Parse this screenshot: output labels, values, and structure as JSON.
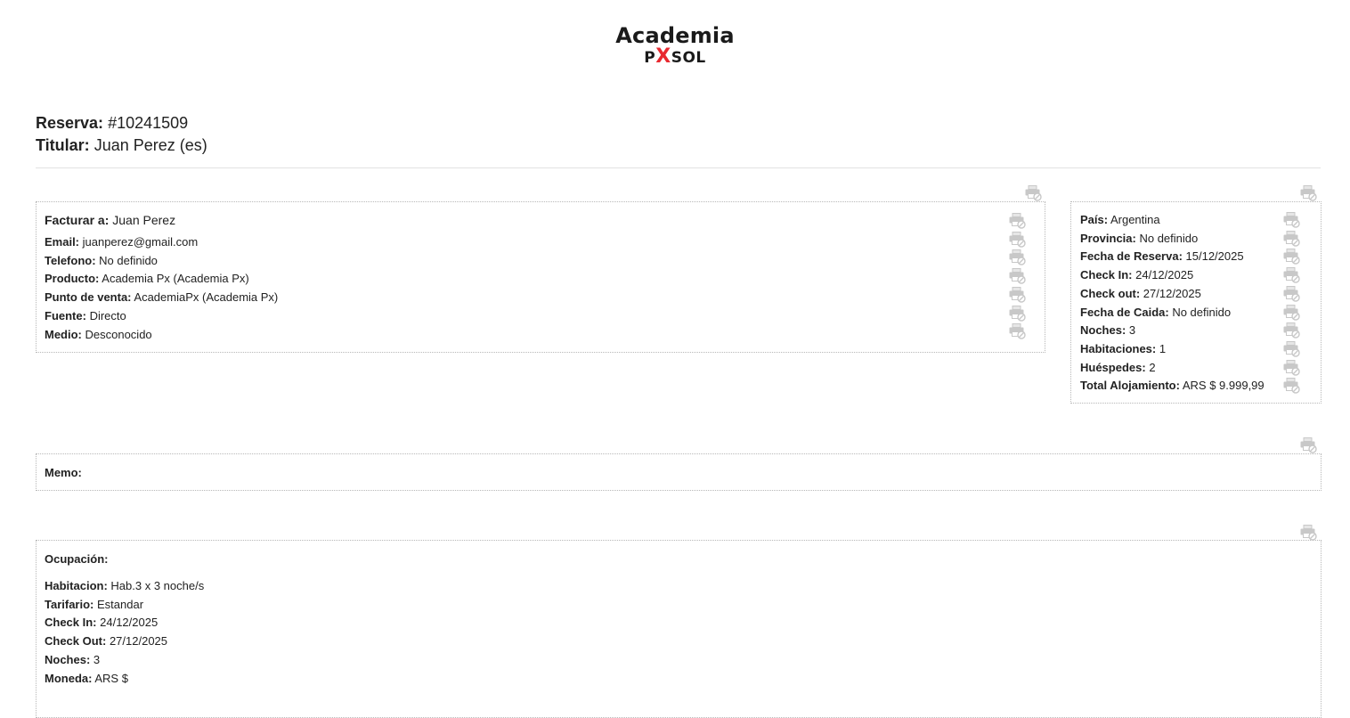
{
  "logo": {
    "title": "Academia",
    "subtitle_left": "P",
    "subtitle_x": "X",
    "subtitle_right": "SOL"
  },
  "header": {
    "reserva_label": "Reserva:",
    "reserva_value": "#10241509",
    "titular_label": "Titular:",
    "titular_value": "Juan Perez (es)"
  },
  "billing": {
    "title_label": "Facturar a:",
    "title_value": "Juan Perez",
    "rows": [
      {
        "label": "Email:",
        "value": "juanperez@gmail.com"
      },
      {
        "label": "Telefono:",
        "value": "No definido"
      },
      {
        "label": "Producto:",
        "value": "Academia Px (Academia Px)"
      },
      {
        "label": "Punto de venta:",
        "value": "AcademiaPx (Academia Px)"
      },
      {
        "label": "Fuente:",
        "value": "Directo"
      },
      {
        "label": "Medio:",
        "value": "Desconocido"
      }
    ]
  },
  "details": {
    "rows": [
      {
        "label": "País:",
        "value": "Argentina"
      },
      {
        "label": "Provincia:",
        "value": "No definido"
      },
      {
        "label": "Fecha de Reserva:",
        "value": "15/12/2025"
      },
      {
        "label": "Check In:",
        "value": "24/12/2025"
      },
      {
        "label": "Check out:",
        "value": "27/12/2025"
      },
      {
        "label": "Fecha de Caida:",
        "value": "No definido"
      },
      {
        "label": "Noches:",
        "value": "3"
      },
      {
        "label": "Habitaciones:",
        "value": "1"
      },
      {
        "label": "Huéspedes:",
        "value": "2"
      },
      {
        "label": "Total Alojamiento:",
        "value": "ARS $ 9.999,99"
      }
    ]
  },
  "memo": {
    "label": "Memo:"
  },
  "occupation": {
    "title": "Ocupación:",
    "rows": [
      {
        "label": "Habitacion:",
        "value": "Hab.3 x 3 noche/s"
      },
      {
        "label": "Tarifario:",
        "value": "Estandar"
      },
      {
        "label": "Check In:",
        "value": "24/12/2025"
      },
      {
        "label": "Check Out:",
        "value": "27/12/2025"
      },
      {
        "label": "Noches:",
        "value": "3"
      },
      {
        "label": "Moneda:",
        "value": "ARS $"
      }
    ]
  },
  "icons": {
    "print_hide": "printer-disabled-icon"
  },
  "colors": {
    "text": "#222222",
    "icon": "#c8c8c8",
    "border": "#b8b8b8",
    "logo_x": "#e8282f"
  }
}
